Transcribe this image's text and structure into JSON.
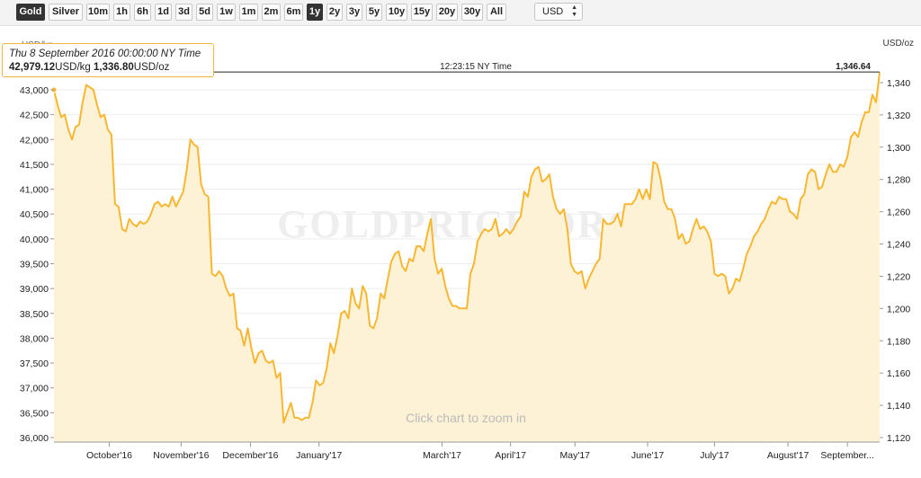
{
  "toolbar": {
    "buttons": [
      {
        "label": "Gold",
        "active": true
      },
      {
        "label": "Silver",
        "active": false
      },
      {
        "label": "10m",
        "active": false
      },
      {
        "label": "1h",
        "active": false
      },
      {
        "label": "6h",
        "active": false
      },
      {
        "label": "1d",
        "active": false
      },
      {
        "label": "3d",
        "active": false
      },
      {
        "label": "5d",
        "active": false
      },
      {
        "label": "1w",
        "active": false
      },
      {
        "label": "1m",
        "active": false
      },
      {
        "label": "2m",
        "active": false
      },
      {
        "label": "6m",
        "active": false
      },
      {
        "label": "1y",
        "active": true
      },
      {
        "label": "2y",
        "active": false
      },
      {
        "label": "3y",
        "active": false
      },
      {
        "label": "5y",
        "active": false
      },
      {
        "label": "10y",
        "active": false
      },
      {
        "label": "15y",
        "active": false
      },
      {
        "label": "20y",
        "active": false
      },
      {
        "label": "30y",
        "active": false
      },
      {
        "label": "All",
        "active": false
      }
    ],
    "currency_select": {
      "value": "USD"
    }
  },
  "tooltip": {
    "date": "Thu 8 September 2016 00:00:00 NY Time",
    "value_kg": "42,979.12",
    "unit_kg": "USD/kg",
    "value_oz": "1,336.80",
    "unit_oz": "USD/oz"
  },
  "chart_data": {
    "type": "area",
    "title": "",
    "watermark": "GOLDPRICE.ORG",
    "crosshair_time": "12:23:15 NY Time",
    "current_value_label": "1,346.64",
    "zoom_hint": "Click chart to zoom in",
    "left_axis": {
      "label": "USD/kg",
      "min": 36000,
      "max": 43000,
      "ticks": [
        "36,000",
        "36,500",
        "37,000",
        "37,500",
        "38,000",
        "38,500",
        "39,000",
        "39,500",
        "40,000",
        "40,500",
        "41,000",
        "41,500",
        "42,000",
        "42,500",
        "43,000"
      ]
    },
    "right_axis": {
      "label": "USD/oz",
      "min": 1120,
      "max": 1340,
      "ticks": [
        "1,120",
        "1,140",
        "1,160",
        "1,180",
        "1,200",
        "1,220",
        "1,240",
        "1,260",
        "1,280",
        "1,300",
        "1,320",
        "1,340"
      ]
    },
    "x_axis_labels": [
      {
        "label": "October'16",
        "pos": 0.067
      },
      {
        "label": "November'16",
        "pos": 0.154
      },
      {
        "label": "December'16",
        "pos": 0.238
      },
      {
        "label": "January'17",
        "pos": 0.321
      },
      {
        "label": "March'17",
        "pos": 0.47
      },
      {
        "label": "April'17",
        "pos": 0.553
      },
      {
        "label": "May'17",
        "pos": 0.631
      },
      {
        "label": "June'17",
        "pos": 0.719
      },
      {
        "label": "July'17",
        "pos": 0.8
      },
      {
        "label": "August'17",
        "pos": 0.889
      },
      {
        "label": "September...",
        "pos": 0.961
      }
    ],
    "series": [
      {
        "unit": "USD/kg",
        "color": "#f7b731",
        "fill": "#fdf2d6",
        "values": [
          43000,
          42700,
          42450,
          42500,
          42200,
          42000,
          42250,
          42300,
          42750,
          43100,
          43050,
          43000,
          42700,
          42450,
          42500,
          42200,
          42100,
          40700,
          40650,
          40200,
          40150,
          40400,
          40300,
          40250,
          40350,
          40300,
          40350,
          40500,
          40700,
          40750,
          40650,
          40700,
          40650,
          40850,
          40650,
          40800,
          40950,
          41400,
          42000,
          41900,
          41850,
          41100,
          40900,
          40850,
          39300,
          39250,
          39350,
          39250,
          39000,
          38850,
          38900,
          38200,
          38150,
          37850,
          38200,
          37800,
          37500,
          37700,
          37750,
          37550,
          37500,
          37550,
          37200,
          37300,
          36300,
          36500,
          36700,
          36400,
          36400,
          36350,
          36400,
          36400,
          36700,
          37150,
          37050,
          37100,
          37400,
          37900,
          37700,
          38050,
          38500,
          38550,
          38400,
          39000,
          38700,
          38600,
          39050,
          38900,
          38250,
          38200,
          38400,
          38900,
          38800,
          39200,
          39550,
          39700,
          39750,
          39450,
          39350,
          39600,
          39550,
          39850,
          39850,
          39750,
          40100,
          40400,
          39600,
          39300,
          39400,
          39050,
          38800,
          38650,
          38650,
          38600,
          38600,
          38600,
          39300,
          39500,
          39950,
          40100,
          40200,
          40150,
          40200,
          40400,
          40050,
          40100,
          40200,
          40100,
          40200,
          40350,
          40450,
          40950,
          40850,
          41250,
          41400,
          41450,
          41150,
          41200,
          41300,
          40850,
          40600,
          40500,
          40600,
          40200,
          39500,
          39350,
          39300,
          39350,
          39000,
          39200,
          39350,
          39500,
          39600,
          40400,
          40300,
          40300,
          40350,
          40500,
          40250,
          40700,
          40700,
          40700,
          40800,
          41000,
          40800,
          41000,
          40800,
          41550,
          41500,
          41200,
          40750,
          40600,
          40600,
          40400,
          40000,
          40100,
          39900,
          39950,
          40200,
          40400,
          40200,
          40250,
          40150,
          39950,
          39300,
          39250,
          39300,
          39250,
          38900,
          39000,
          39200,
          39150,
          39400,
          39700,
          39850,
          40050,
          40150,
          40300,
          40400,
          40600,
          40750,
          40700,
          40850,
          40800,
          40800,
          40550,
          40500,
          40400,
          40800,
          40900,
          41300,
          41400,
          41350,
          41000,
          41050,
          41300,
          41500,
          41350,
          41350,
          41500,
          41450,
          41650,
          42050,
          42150,
          42050,
          42350,
          42550,
          42550,
          42900,
          42750,
          43350
        ]
      }
    ]
  }
}
